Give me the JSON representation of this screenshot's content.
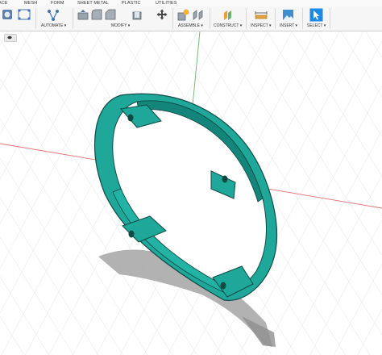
{
  "tabs": [
    "ACE",
    "MESH",
    "FORM",
    "SHEET METAL",
    "PLASTIC",
    "UTILITIES"
  ],
  "toolbar": {
    "groups": [
      "AUTOMATE",
      "MODIFY",
      "ASSEMBLE",
      "CONSTRUCT",
      "INSPECT",
      "INSERT",
      "SELECT"
    ],
    "dropdown_glyph": "▾"
  },
  "icons": {
    "create": [
      "create-sketch-icon",
      "create-form-icon"
    ],
    "automate": "automate-icon",
    "modify": [
      "press-pull-icon",
      "fillet-icon",
      "chamfer-icon",
      "shell-icon",
      "move-icon"
    ],
    "assemble": [
      "new-component-icon",
      "joint-icon"
    ],
    "construct": "offset-plane-icon",
    "inspect": "measure-icon",
    "insert": "insert-image-icon",
    "select": "select-cursor-icon"
  },
  "viewport": {
    "background": "#ffffff",
    "grid_color": "#d6d6d6",
    "axis_red": "#e07070",
    "axis_green": "#6ab36a",
    "model_color": "#1fa89a",
    "model_shadow": "#9c9c9c",
    "model": "teal ring with four mounting tabs"
  }
}
